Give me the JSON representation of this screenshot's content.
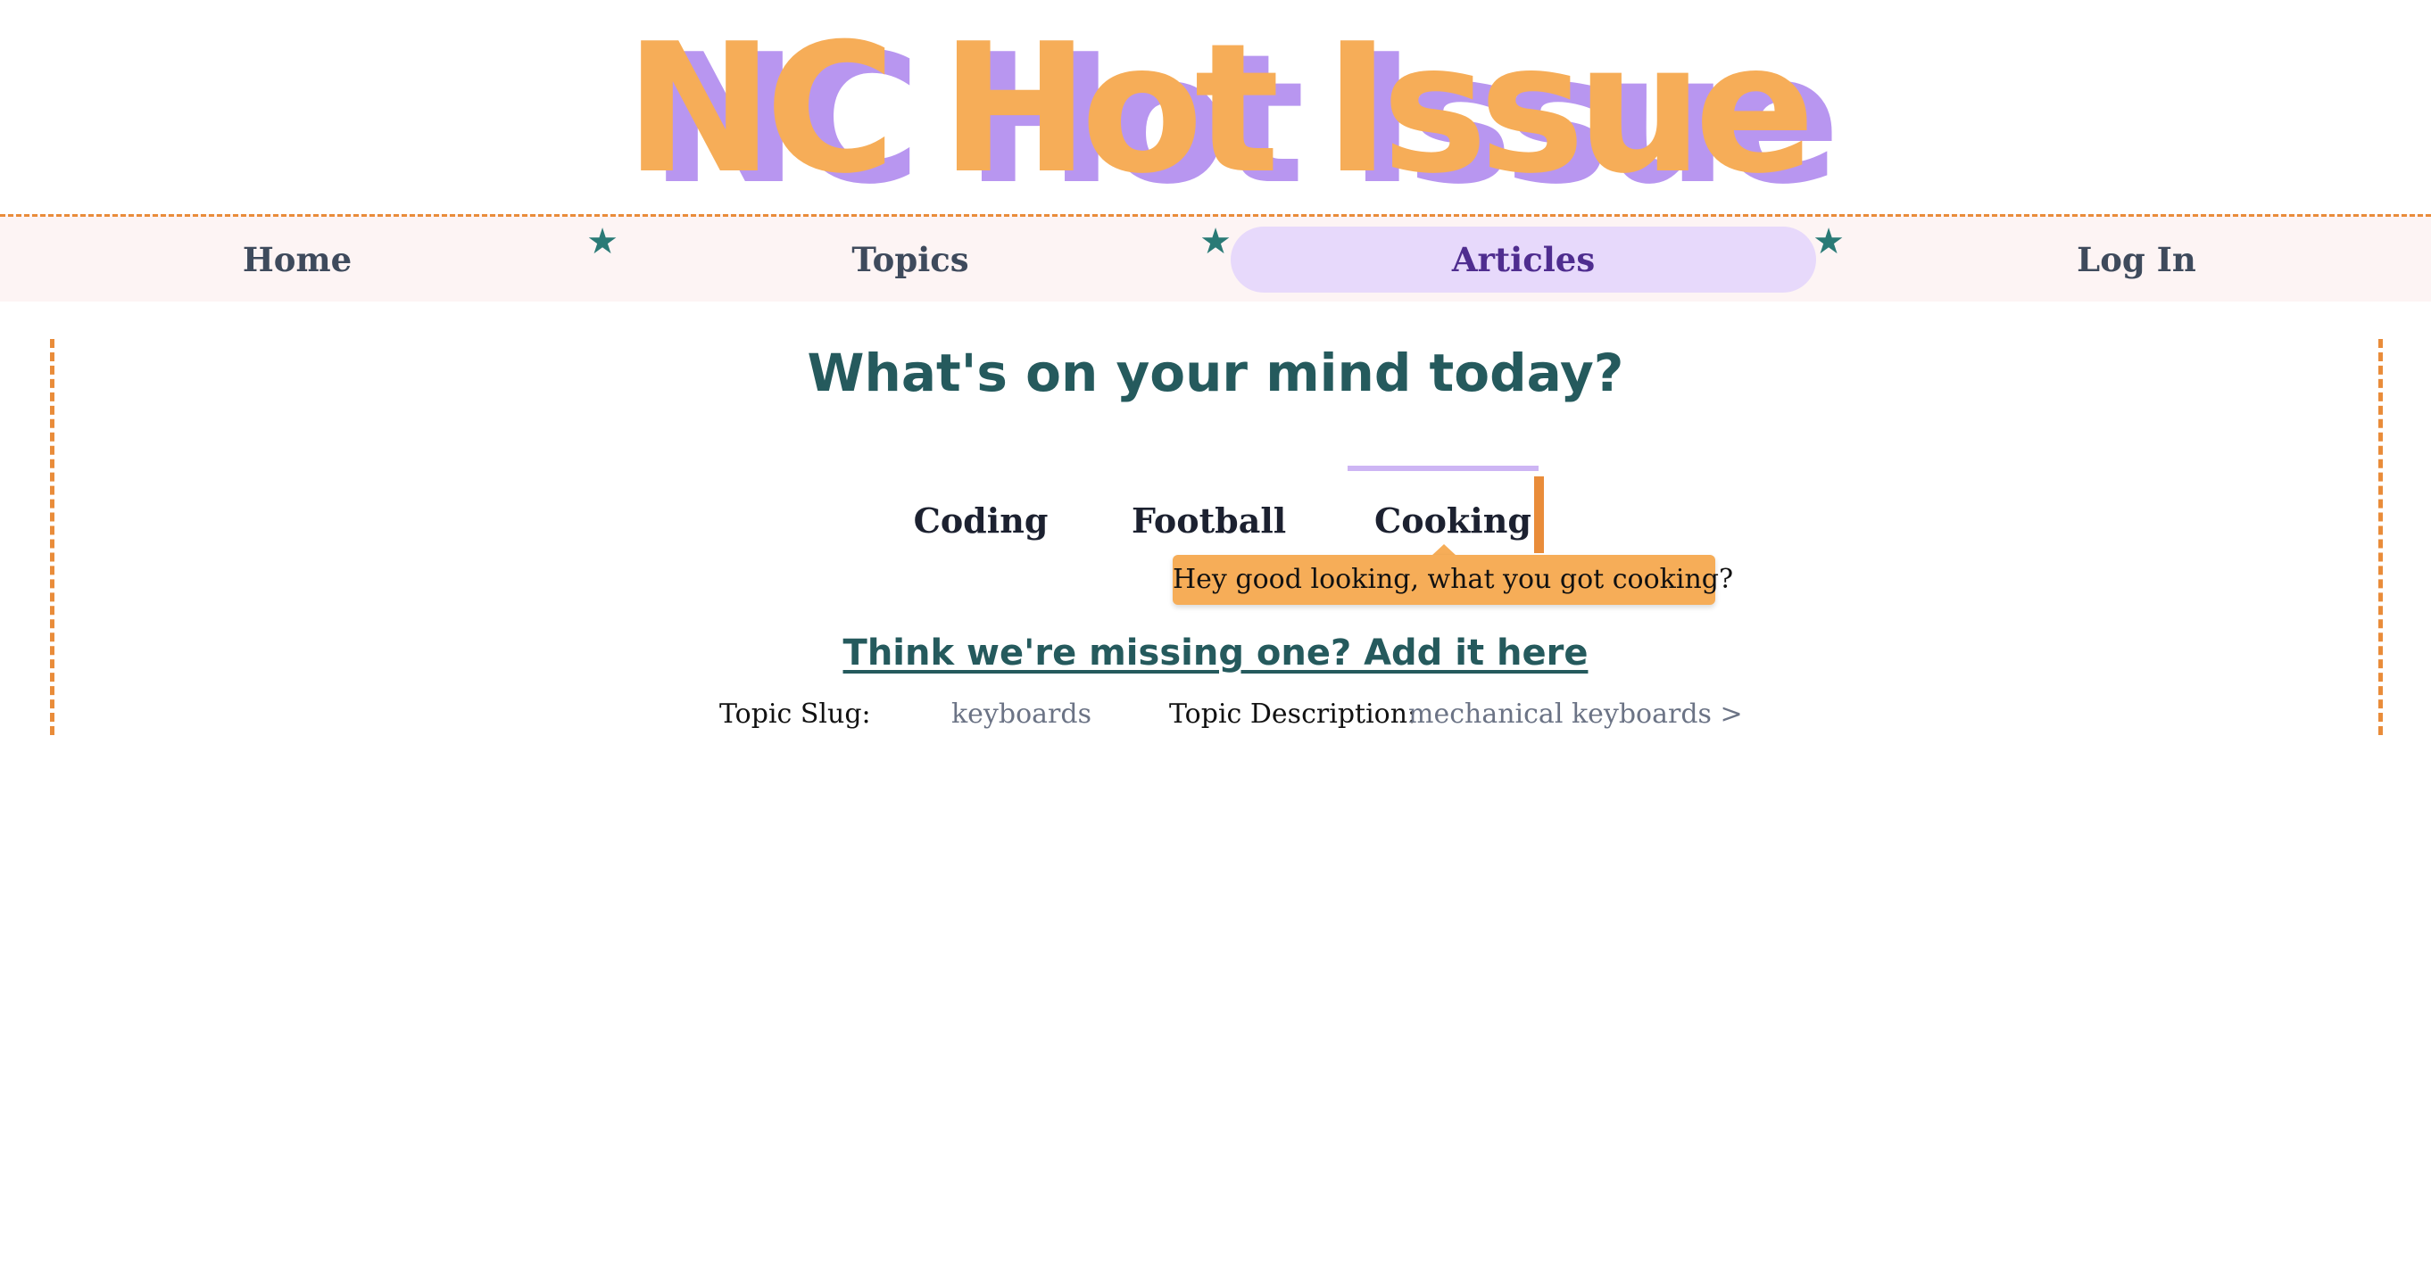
{
  "site": {
    "title": "NC Hot Issue",
    "colors": {
      "title_fill": "#f6ad58",
      "title_shadow": "#b896f0",
      "accent_orange": "#e98c3a",
      "teal": "#255a5d",
      "nav_active_bg": "#e7d9fb"
    }
  },
  "nav": {
    "items": [
      {
        "label": "Home",
        "active": false
      },
      {
        "label": "Topics",
        "active": false
      },
      {
        "label": "Articles",
        "active": true
      },
      {
        "label": "Log In",
        "active": false
      }
    ],
    "separator_icon": "star-icon",
    "separator_glyph": "★"
  },
  "main": {
    "heading": "What's on your mind today?",
    "topics": [
      {
        "label": "Coding",
        "selected": false
      },
      {
        "label": "Football",
        "selected": false
      },
      {
        "label": "Cooking",
        "selected": true
      }
    ],
    "tooltip": "Hey good looking, what you got cooking?",
    "add_link": "Think we're missing one? Add it here",
    "topic_slug_label": "Topic Slug:",
    "topic_slug_value": "keyboards",
    "topic_description_label": "Topic Description:",
    "topic_description_value": "mechanical keyboards >"
  }
}
